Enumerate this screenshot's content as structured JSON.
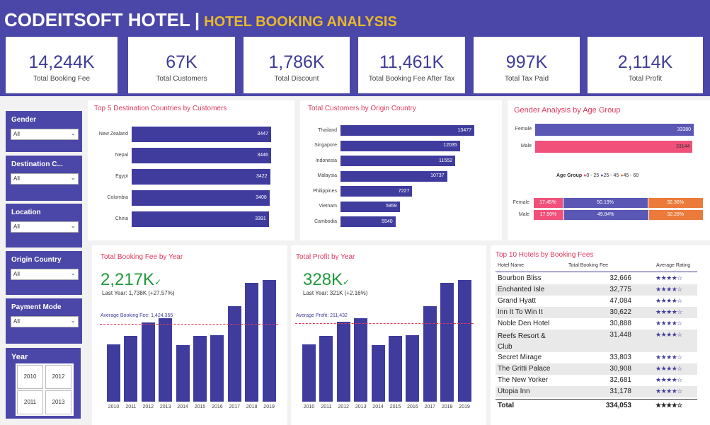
{
  "header": {
    "brand": "CODEITSOFT HOTEL",
    "separator": "|",
    "subtitle": "HOTEL BOOKING ANALYSIS"
  },
  "kpis": [
    {
      "value": "14,244K",
      "label": "Total Booking Fee"
    },
    {
      "value": "67K",
      "label": "Total Customers"
    },
    {
      "value": "1,786K",
      "label": "Total Discount"
    },
    {
      "value": "11,461K",
      "label": "Total Booking Fee After Tax"
    },
    {
      "value": "997K",
      "label": "Total Tax Paid"
    },
    {
      "value": "2,114K",
      "label": "Total Profit"
    }
  ],
  "slicers": [
    {
      "label": "Gender",
      "value": "All"
    },
    {
      "label": "Destination C...",
      "value": "All"
    },
    {
      "label": "Location",
      "value": "All"
    },
    {
      "label": "Origin Country",
      "value": "All"
    },
    {
      "label": "Payment Mode",
      "value": "All"
    }
  ],
  "year_slicer": {
    "label": "Year",
    "options": [
      "2010",
      "2012",
      "2011",
      "2013"
    ]
  },
  "colors": {
    "primary": "#4b47a8",
    "bar": "#3f3c9e",
    "accent": "#e8b92a",
    "title": "#e0395c",
    "pink": "#f0507a",
    "orange": "#ec7a3a",
    "green": "#1f9a3c"
  },
  "chart_data": [
    {
      "type": "bar",
      "title": "Top 5 Destination Countries by Customers",
      "orientation": "horizontal",
      "categories": [
        "New Zealand",
        "Nepal",
        "Egypt",
        "Colombia",
        "China"
      ],
      "values": [
        3447,
        3446,
        3422,
        3408,
        3391
      ]
    },
    {
      "type": "bar",
      "title": "Total Customers by Origin Country",
      "orientation": "horizontal",
      "categories": [
        "Thailand",
        "Singapore",
        "Indonesia",
        "Malaysia",
        "Philippines",
        "Vietnam",
        "Cambodia"
      ],
      "values": [
        13477,
        12035,
        11552,
        10737,
        7227,
        5959,
        5540
      ]
    },
    {
      "type": "bar",
      "title": "Gender Analysis by Age Group",
      "orientation": "horizontal",
      "categories": [
        "Female",
        "Male"
      ],
      "values": [
        33380,
        33144
      ],
      "legend_title": "Age Group",
      "legend": [
        "0 - 25",
        "25 - 45",
        "45 - 60"
      ],
      "stacked": [
        {
          "label": "Female",
          "values": [
            "17.45%",
            "50.19%",
            "32.36%"
          ],
          "pct": [
            17.45,
            50.19,
            32.36
          ]
        },
        {
          "label": "Male",
          "values": [
            "17.90%",
            "49.84%",
            "32.26%"
          ],
          "pct": [
            17.9,
            49.84,
            32.26
          ]
        }
      ]
    },
    {
      "type": "bar",
      "title": "Total Booking Fee by Year",
      "kpi_value": "2,217K",
      "kpi_sub": "Last Year: 1,738K (+27.57%)",
      "reference_label": "Average Booking Fee: 1,424,365",
      "reference_value": 1424365,
      "categories": [
        "2010",
        "2011",
        "2012",
        "2013",
        "2014",
        "2015",
        "2016",
        "2017",
        "2018",
        "2019"
      ],
      "values": [
        1050000,
        1200000,
        1450000,
        1520000,
        1030000,
        1200000,
        1210000,
        1750000,
        2170000,
        2217000
      ],
      "ylim": [
        0,
        2300000
      ]
    },
    {
      "type": "bar",
      "title": "Total Profit by Year",
      "kpi_value": "328K",
      "kpi_sub": "Last Year: 321K (+2.16%)",
      "reference_label": "Average Profit: 211,432",
      "reference_value": 211432,
      "categories": [
        "2010",
        "2011",
        "2012",
        "2013",
        "2014",
        "2015",
        "2016",
        "2017",
        "2018",
        "2019"
      ],
      "values": [
        155000,
        178000,
        215000,
        225000,
        153000,
        177000,
        180000,
        258000,
        321000,
        328000
      ],
      "ylim": [
        0,
        340000
      ]
    }
  ],
  "table": {
    "title": "Top 10 Hotels by Booking Fees",
    "headers": [
      "Hotel Name",
      "Total Booking Fee",
      "Average Rating"
    ],
    "rows": [
      {
        "name": "Bourbon Bliss",
        "fee": "32,666",
        "rating": "★★★★☆"
      },
      {
        "name": "Enchanted Isle",
        "fee": "32,775",
        "rating": "★★★★☆"
      },
      {
        "name": "Grand Hyatt",
        "fee": "47,084",
        "rating": "★★★★☆"
      },
      {
        "name": "Inn It To Win It",
        "fee": "30,622",
        "rating": "★★★★☆"
      },
      {
        "name": "Noble Den Hotel",
        "fee": "30,888",
        "rating": "★★★★☆"
      },
      {
        "name": "Reefs Resort &",
        "name2": "Club",
        "fee": "31,448",
        "rating": "★★★★☆"
      },
      {
        "name": "Secret Mirage",
        "fee": "33,803",
        "rating": "★★★★☆"
      },
      {
        "name": "The Gritti Palace",
        "fee": "30,908",
        "rating": "★★★★☆"
      },
      {
        "name": "The New Yorker",
        "fee": "32,681",
        "rating": "★★★★☆"
      },
      {
        "name": "Utopia Inn",
        "fee": "31,178",
        "rating": "★★★★☆"
      }
    ],
    "total_label": "Total",
    "total_fee": "334,053",
    "total_rating": "★★★★☆"
  }
}
